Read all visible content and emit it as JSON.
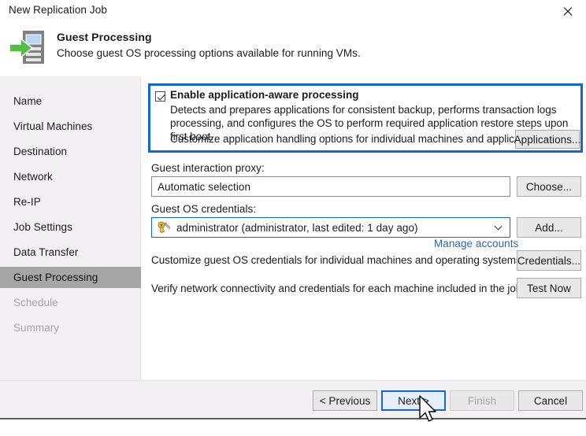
{
  "window": {
    "title": "New Replication Job",
    "close_icon": "close-icon"
  },
  "header": {
    "icon": "replication-server-arrow-icon",
    "title": "Guest Processing",
    "subtitle": "Choose guest OS processing options available for running VMs."
  },
  "sidebar": {
    "items": [
      {
        "label": "Name",
        "state": "enabled"
      },
      {
        "label": "Virtual Machines",
        "state": "enabled"
      },
      {
        "label": "Destination",
        "state": "enabled"
      },
      {
        "label": "Network",
        "state": "enabled"
      },
      {
        "label": "Re-IP",
        "state": "enabled"
      },
      {
        "label": "Job Settings",
        "state": "enabled"
      },
      {
        "label": "Data Transfer",
        "state": "enabled"
      },
      {
        "label": "Guest Processing",
        "state": "active"
      },
      {
        "label": "Schedule",
        "state": "disabled"
      },
      {
        "label": "Summary",
        "state": "disabled"
      }
    ]
  },
  "main": {
    "app_aware": {
      "checkbox_label": "Enable application-aware processing",
      "checked": true,
      "description": "Detects and prepares applications for consistent backup, performs transaction logs processing, and configures the OS to perform required application restore steps upon first boot.",
      "customize_text": "Customize application handling options for individual machines and applications",
      "applications_button": "Applications...",
      "highlight_color": "#1565d8"
    },
    "guest_interaction_proxy": {
      "label": "Guest interaction proxy:",
      "value": "Automatic selection",
      "choose_button": "Choose..."
    },
    "guest_os_credentials": {
      "label": "Guest OS credentials:",
      "value": "administrator (administrator, last edited: 1 day ago)",
      "icon": "key-icon",
      "add_button": "Add...",
      "manage_link": "Manage accounts"
    },
    "customize_credentials": {
      "text": "Customize guest OS credentials for individual machines and operating systems",
      "button": "Credentials..."
    },
    "verify_connectivity": {
      "text": "Verify network connectivity and credentials for each machine included in the job",
      "button": "Test Now"
    }
  },
  "footer": {
    "previous": "< Previous",
    "next": "Next >",
    "finish": "Finish",
    "cancel": "Cancel"
  }
}
